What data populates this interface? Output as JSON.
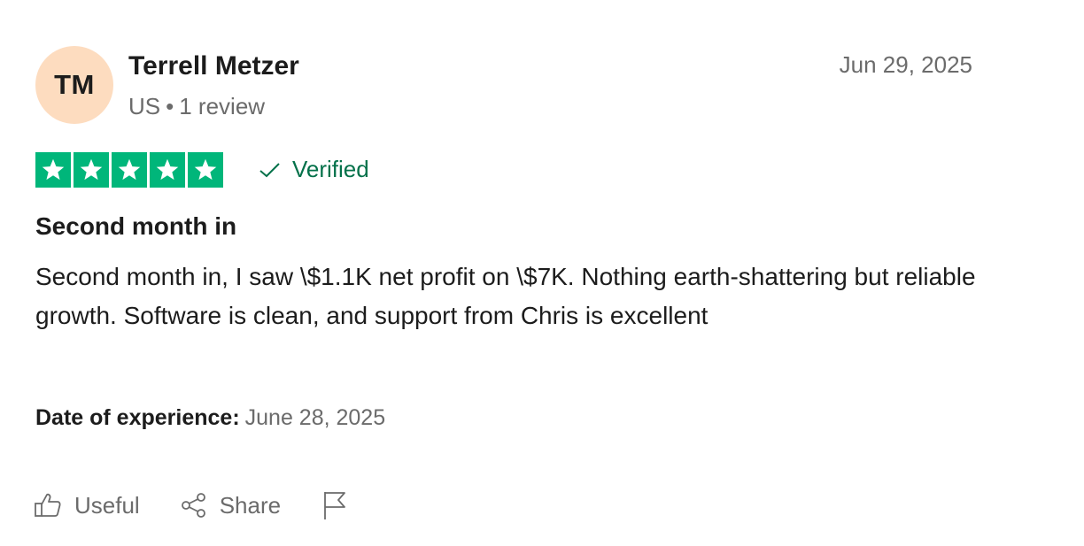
{
  "review": {
    "avatar_initials": "TM",
    "avatar_color": "#fddcbf",
    "reviewer_name": "Terrell Metzer",
    "country": "US",
    "separator": "•",
    "review_count": "1 review",
    "date": "Jun 29, 2025",
    "rating": 5,
    "rating_max": 5,
    "star_color": "#00b67a",
    "verified_label": "Verified",
    "verified_color": "#04714a",
    "title": "Second month in",
    "body": "Second month in, I saw \\$1.1K net profit on \\$7K. Nothing earth-shattering but reliable growth. Software is clean, and support from Chris is excellent",
    "experience_label": "Date of experience:",
    "experience_date": "June 28, 2025"
  },
  "actions": {
    "useful_label": "Useful",
    "useful_icon": "thumbs-up-icon",
    "share_label": "Share",
    "share_icon": "share-icon",
    "report_icon": "flag-icon"
  }
}
